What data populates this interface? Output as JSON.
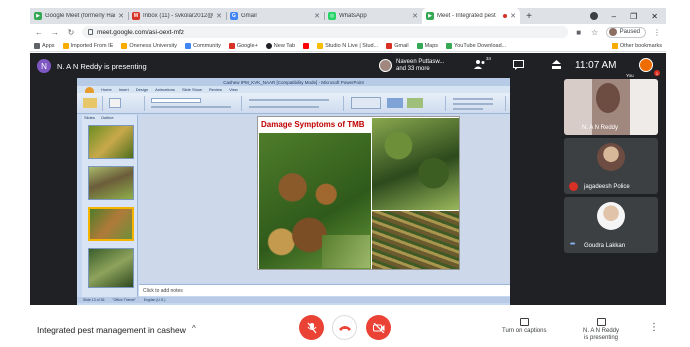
{
  "tabs": [
    {
      "label": "Google Meet (formerly Hang",
      "color": "#34a853",
      "glyph": "▶",
      "active": false
    },
    {
      "label": "Inbox (11) - svkolar2012@",
      "color": "#d93025",
      "glyph": "M",
      "active": false
    },
    {
      "label": "Gmail",
      "color": "#4285f4",
      "glyph": "G",
      "active": false
    },
    {
      "label": "WhatsApp",
      "color": "#25d366",
      "glyph": "◎",
      "active": false
    },
    {
      "label": "Meet - Integrated pest",
      "color": "#34a853",
      "glyph": "▶",
      "active": true
    }
  ],
  "address": {
    "url": "meet.google.com/asi-oext-mfz",
    "profile_status": "Paused"
  },
  "bookmarks": {
    "items": [
      {
        "label": "Apps",
        "color": "#5f6368"
      },
      {
        "label": "Imported From IE",
        "color": "#f9ab00"
      },
      {
        "label": "Oneness University",
        "color": "#f9ab00"
      },
      {
        "label": "Community",
        "color": "#4285f4"
      },
      {
        "label": "Google+",
        "color": "#d93025"
      },
      {
        "label": "New Tab",
        "color": "#202124"
      },
      {
        "label": "",
        "color": "#ff0000"
      },
      {
        "label": "Studio N Live | Stud...",
        "color": "#fbbc04"
      },
      {
        "label": "Gmail",
        "color": "#d93025"
      },
      {
        "label": "Maps",
        "color": "#34a853"
      },
      {
        "label": "YouTube Download...",
        "color": "#34a853"
      }
    ],
    "other": "Other bookmarks"
  },
  "meet": {
    "presenter_initial": "N",
    "presenter_label": "N. A N Reddy is presenting",
    "others_line1": "Naveen Puttasw...",
    "others_line2": "and 33 more",
    "participant_count": "34",
    "time": "11:07 AM",
    "you_label": "You",
    "notification_count": "1"
  },
  "shared_screen": {
    "window_title": "Cashew IPM_KVK_NAAR [Compatibility Mode] - Microsoft PowerPoint",
    "ribbon_tabs": [
      "Home",
      "Insert",
      "Design",
      "Animations",
      "Slide Show",
      "Review",
      "View"
    ],
    "panel_tabs": [
      "Slides",
      "Outline"
    ],
    "slide_title": "Damage Symptoms of TMB",
    "notes_placeholder": "Click to add notes",
    "status": [
      "Slide 13 of 36",
      "\"Office Theme\"",
      "English (U.S.)"
    ]
  },
  "participants": [
    {
      "name": "N. A N Reddy",
      "type": "video"
    },
    {
      "name": "jagadeesh Police",
      "type": "muted"
    },
    {
      "name": "Goudra Lakkan",
      "type": "speaking"
    }
  ],
  "bottom": {
    "meeting_title": "Integrated pest management in cashew",
    "captions_label": "Turn on captions",
    "presenting_line1": "N. A N Reddy",
    "presenting_line2": "is presenting"
  },
  "colors": {
    "meet_bg": "#202124",
    "end_call": "#ea4335",
    "slide_title": "#c00000"
  }
}
